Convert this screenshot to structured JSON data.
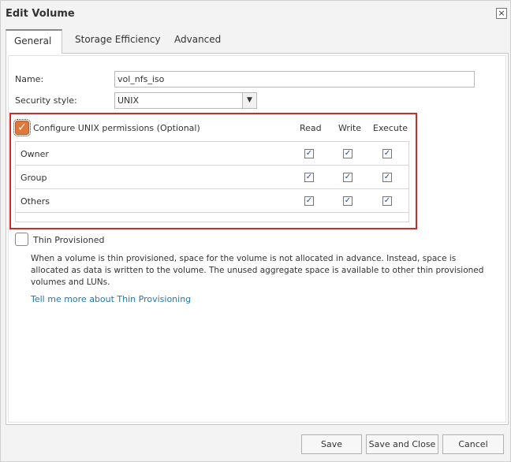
{
  "dialog": {
    "title": "Edit Volume",
    "close_label": "×"
  },
  "tabs": [
    {
      "label": "General",
      "active": true
    },
    {
      "label": "Storage Efficiency",
      "active": false
    },
    {
      "label": "Advanced",
      "active": false
    }
  ],
  "form": {
    "name_label": "Name:",
    "name_value": "vol_nfs_iso",
    "security_label": "Security style:",
    "security_value": "UNIX",
    "dropdown_glyph": "▼"
  },
  "permissions": {
    "configure_label": "Configure UNIX permissions (Optional)",
    "configure_checked": true,
    "columns": [
      "Read",
      "Write",
      "Execute"
    ],
    "rows": [
      {
        "label": "Owner",
        "read": true,
        "write": true,
        "execute": true
      },
      {
        "label": "Group",
        "read": true,
        "write": true,
        "execute": true
      },
      {
        "label": "Others",
        "read": true,
        "write": true,
        "execute": true
      }
    ],
    "check_glyph": "✓"
  },
  "thin": {
    "label": "Thin Provisioned",
    "checked": false,
    "description": "When a volume is thin provisioned, space for the volume is not allocated in advance. Instead, space is allocated as data is written to the volume. The unused aggregate space is available to other thin provisioned volumes and LUNs.",
    "link": "Tell me more about Thin Provisioning"
  },
  "footer": {
    "save": "Save",
    "save_close": "Save and Close",
    "cancel": "Cancel"
  }
}
